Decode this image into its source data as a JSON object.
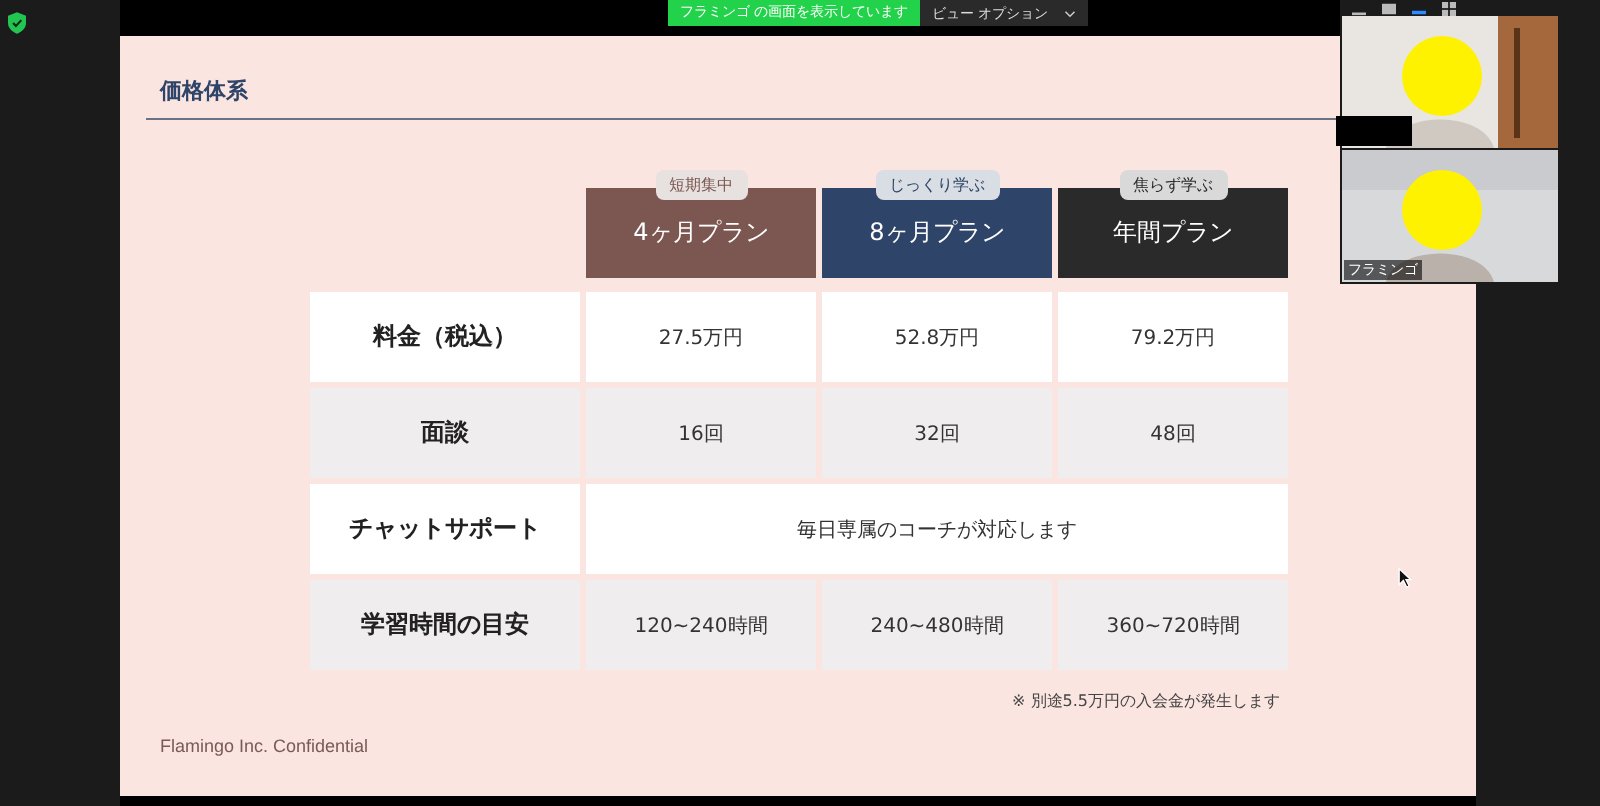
{
  "meeting_bar": {
    "sharing_banner": "フラミンゴ の画面を表示しています",
    "view_options": "ビュー オプション"
  },
  "slide": {
    "title": "価格体系",
    "plans": [
      {
        "tag": "短期集中",
        "name": "4ヶ月プラン",
        "color": "#7c5650"
      },
      {
        "tag": "じっくり学ぶ",
        "name": "8ヶ月プラン",
        "color": "#2e4468"
      },
      {
        "tag": "焦らず学ぶ",
        "name": "年間プラン",
        "color": "#2b2a2a"
      }
    ],
    "rows": [
      {
        "kind": "split",
        "label": "料金（税込）",
        "shaded": false,
        "cells": [
          "27.5万円",
          "52.8万円",
          "79.2万円"
        ]
      },
      {
        "kind": "split",
        "label": "面談",
        "shaded": true,
        "cells": [
          "16回",
          "32回",
          "48回"
        ]
      },
      {
        "kind": "merged",
        "label": "チャットサポート",
        "shaded": false,
        "text": "毎日専属のコーチが対応します"
      },
      {
        "kind": "split",
        "label": "学習時間の目安",
        "shaded": true,
        "cells": [
          "120~240時間",
          "240~480時間",
          "360~720時間"
        ]
      }
    ],
    "note": "※ 別途5.5万円の入会金が発生します",
    "footer": "Flamingo Inc. Confidential"
  },
  "participants": [
    {
      "kind": "picture"
    },
    {
      "kind": "picture",
      "name": "フラミンゴ"
    }
  ]
}
